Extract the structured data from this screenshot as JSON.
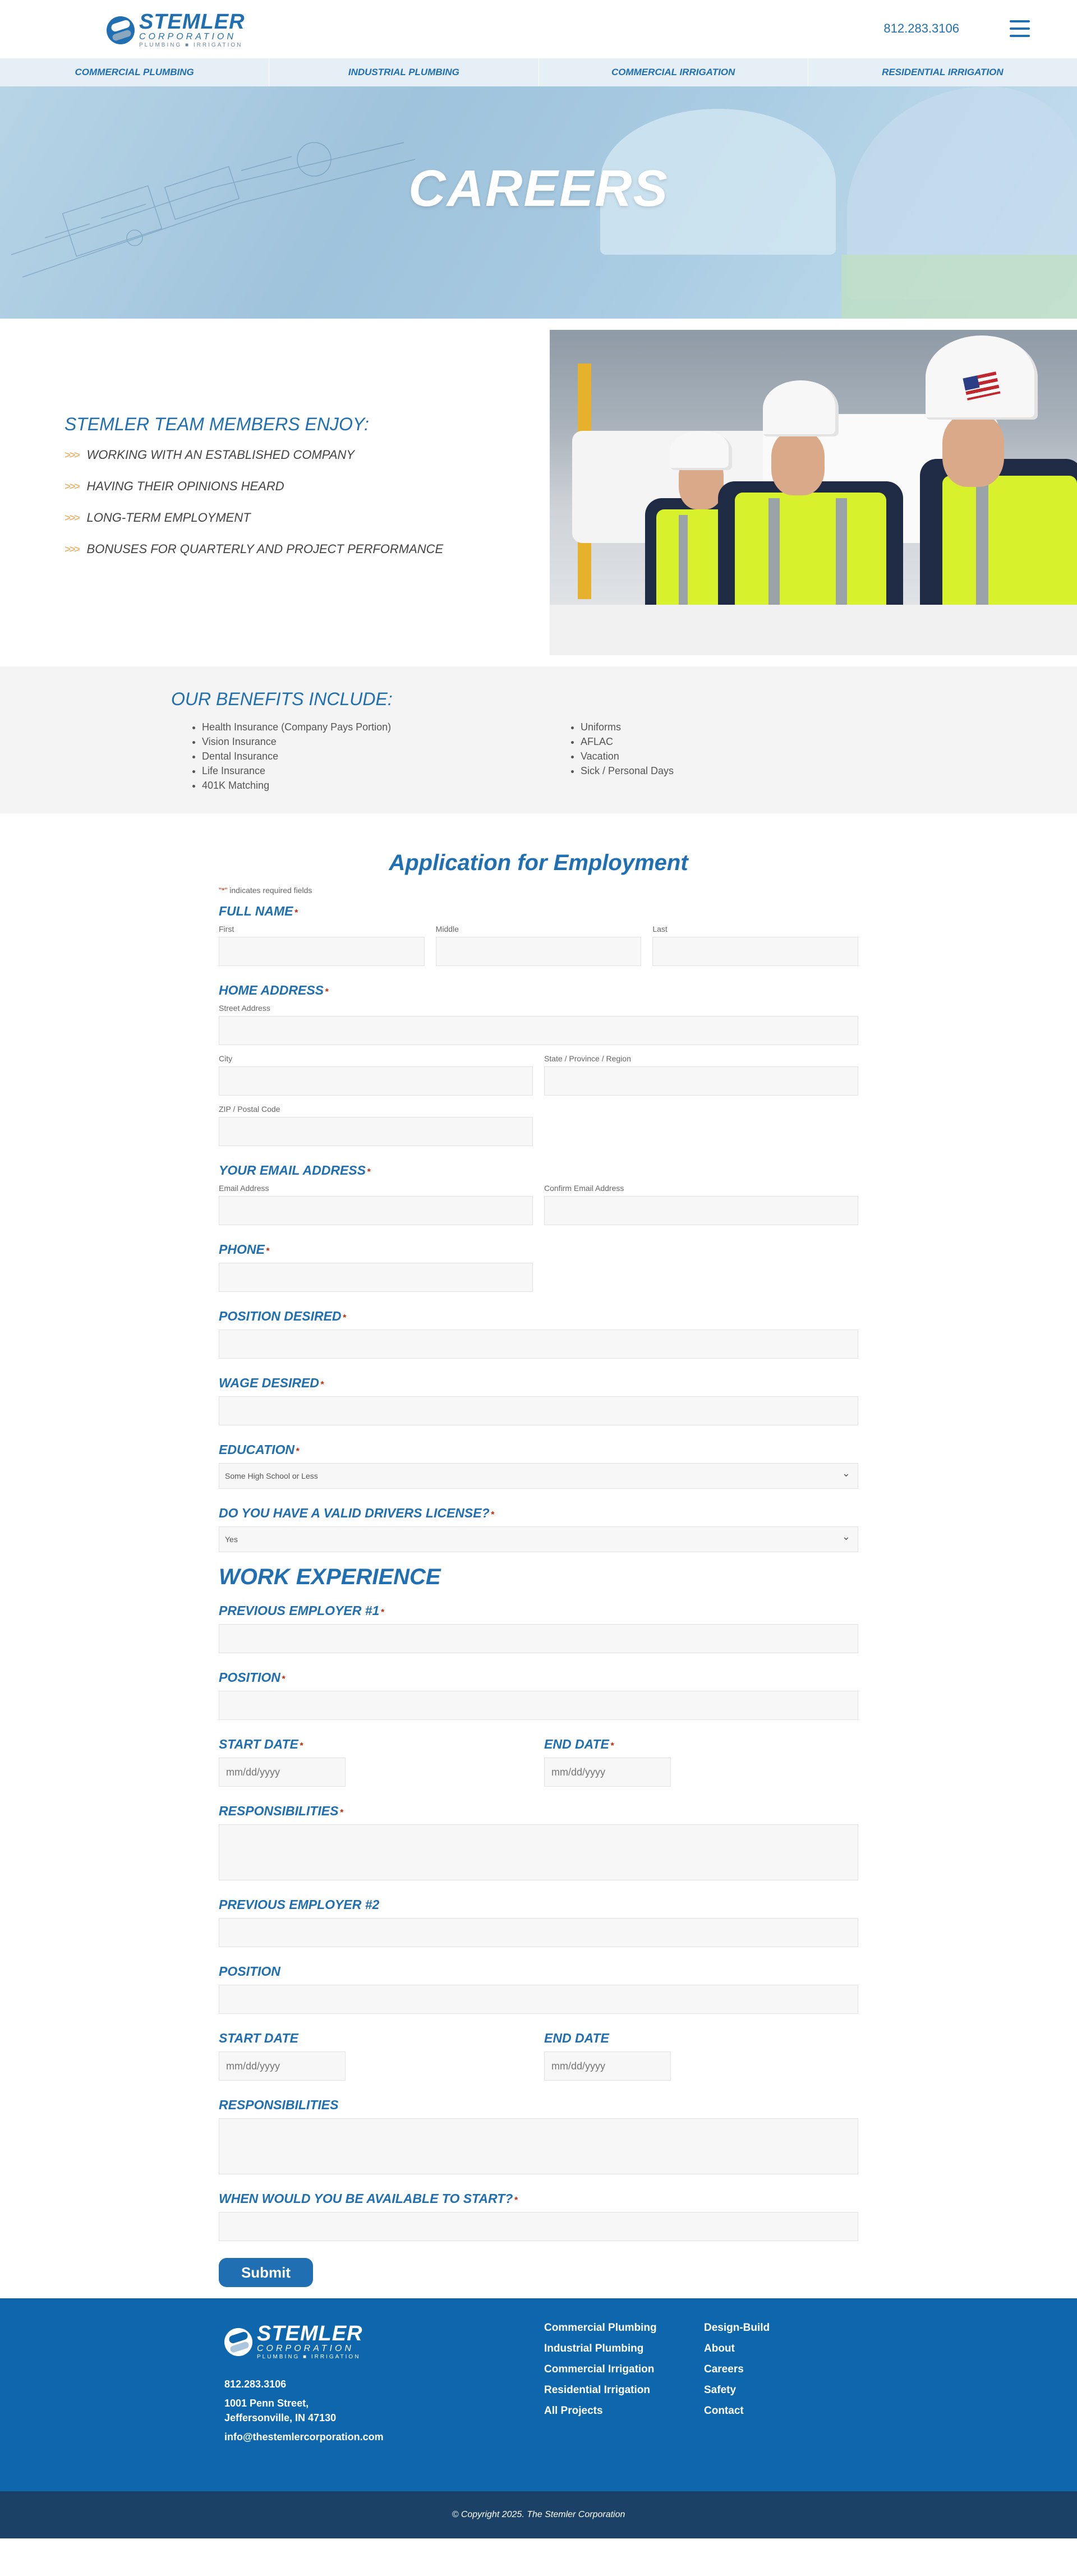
{
  "header": {
    "logo_word": "STEMLER",
    "logo_sub": "CORPORATION",
    "logo_tag": "PLUMBING ■ IRRIGATION",
    "phone": "812.283.3106"
  },
  "services_nav": [
    {
      "label": "COMMERCIAL PLUMBING"
    },
    {
      "label": "INDUSTRIAL PLUMBING"
    },
    {
      "label": "COMMERCIAL IRRIGATION"
    },
    {
      "label": "RESIDENTIAL IRRIGATION"
    }
  ],
  "hero": {
    "title": "CAREERS"
  },
  "enjoy": {
    "heading": "STEMLER TEAM MEMBERS ENJOY:",
    "bullet_glyph": ">>>",
    "items": [
      "WORKING WITH AN ESTABLISHED COMPANY",
      "HAVING THEIR OPINIONS HEARD",
      "LONG-TERM EMPLOYMENT",
      "BONUSES FOR QUARTERLY AND PROJECT PERFORMANCE"
    ]
  },
  "benefits": {
    "heading": "OUR BENEFITS INCLUDE:",
    "col1": [
      "Health Insurance (Company Pays Portion)",
      "Vision Insurance",
      "Dental Insurance",
      "Life Insurance",
      "401K Matching"
    ],
    "col2": [
      "Uniforms",
      "AFLAC",
      "Vacation",
      "Sick / Personal Days"
    ]
  },
  "form": {
    "title": "Application for Employment",
    "required_note_star": "\"*\"",
    "required_note": " indicates required fields",
    "required_marker": "*",
    "full_name": {
      "label": "FULL NAME",
      "first": "First",
      "middle": "Middle",
      "last": "Last"
    },
    "home_address": {
      "label": "HOME ADDRESS",
      "street": "Street Address",
      "city": "City",
      "state": "State / Province / Region",
      "zip": "ZIP / Postal Code"
    },
    "email": {
      "label": "YOUR EMAIL ADDRESS",
      "email": "Email Address",
      "confirm": "Confirm Email Address"
    },
    "phone": {
      "label": "PHONE"
    },
    "position_desired": {
      "label": "POSITION DESIRED"
    },
    "wage_desired": {
      "label": "WAGE DESIRED"
    },
    "education": {
      "label": "EDUCATION",
      "selected": "Some High School or Less"
    },
    "license": {
      "label": "DO YOU HAVE A VALID DRIVERS LICENSE?",
      "selected": "Yes"
    },
    "work_experience": "WORK EXPERIENCE",
    "employer1": {
      "label": "PREVIOUS EMPLOYER #1",
      "position": "POSITION",
      "start": "START DATE",
      "end": "END DATE",
      "responsibilities": "RESPONSIBILITIES"
    },
    "employer2": {
      "label": "PREVIOUS EMPLOYER #2",
      "position": "POSITION",
      "start": "START DATE",
      "end": "END DATE",
      "responsibilities": "RESPONSIBILITIES"
    },
    "date_placeholder": "mm/dd/yyyy",
    "available": {
      "label": "WHEN WOULD YOU BE AVAILABLE TO START?"
    },
    "submit": "Submit"
  },
  "footer": {
    "phone": "812.283.3106",
    "address1": "1001 Penn Street,",
    "address2": "Jeffersonville, IN 47130",
    "email": "info@thestemlercorporation.com",
    "links_col1": [
      "Commercial Plumbing",
      "Industrial Plumbing",
      "Commercial Irrigation",
      "Residential Irrigation",
      "All Projects"
    ],
    "links_col2": [
      "Design-Build",
      "About",
      "Careers",
      "Safety",
      "Contact"
    ],
    "copyright": "© Copyright 2025. The Stemler Corporation"
  },
  "colors": {
    "brand_blue": "#1f6fb2",
    "footer_blue": "#0e67ad",
    "copyright_bar": "#1b4166",
    "required_red": "#c02b0a"
  }
}
